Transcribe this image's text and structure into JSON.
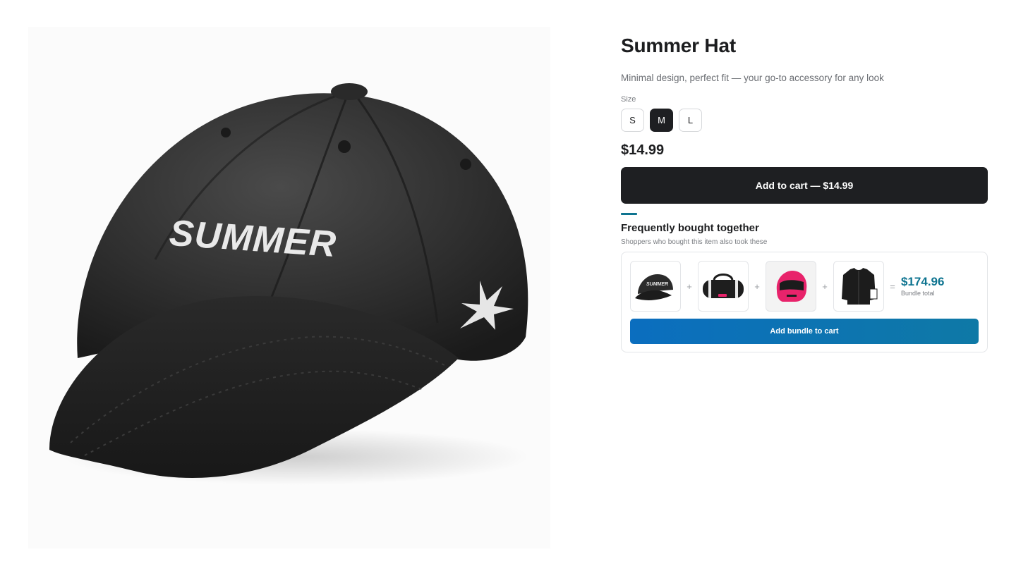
{
  "product": {
    "title": "Summer Hat",
    "subtitle": "Minimal design, perfect fit — your go-to accessory for any look",
    "image_text": "SUMMER",
    "size_label": "Size",
    "sizes": [
      "S",
      "M",
      "L"
    ],
    "selected_size": "M",
    "price": "$14.99",
    "add_to_cart_label": "Add to cart — $14.99"
  },
  "bundle": {
    "title": "Frequently bought together",
    "subtitle": "Shoppers who bought this item also took these",
    "items": [
      {
        "icon": "cap-thumbnail"
      },
      {
        "icon": "duffel-bag-thumbnail"
      },
      {
        "icon": "pink-helmet-thumbnail"
      },
      {
        "icon": "black-jacket-thumbnail"
      }
    ],
    "plus_symbol": "+",
    "equals_symbol": "=",
    "total": "$174.96",
    "total_label": "Bundle total",
    "button_label": "Add bundle to cart"
  },
  "colors": {
    "accent": "#0e7490",
    "dark_button": "#1e1f22",
    "bundle_button_start": "#0b6ebf",
    "bundle_button_end": "#0e79a6",
    "helmet": "#e8236b"
  }
}
